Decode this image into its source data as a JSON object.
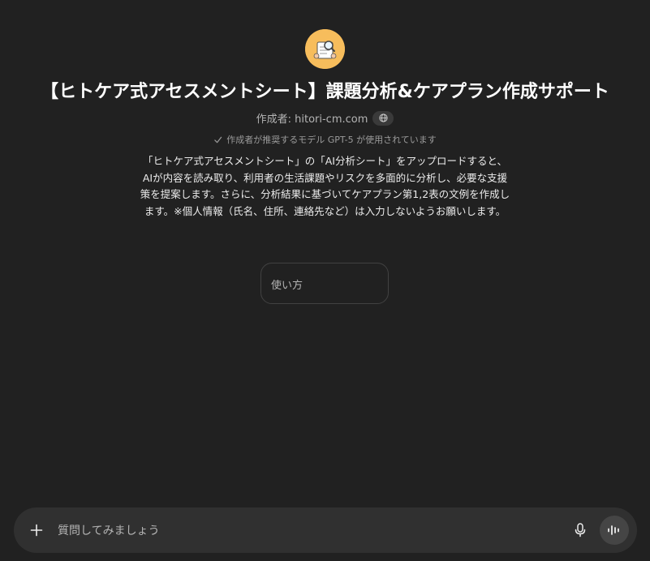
{
  "gpt": {
    "title": "【ヒトケア式アセスメントシート】課題分析&ケアプラン作成サポート",
    "author_label": "作成者: hitori-cm.com",
    "model_note": "作成者が推奨するモデル GPT-5 が使用されています",
    "description": "「ヒトケア式アセスメントシート」の「AI分析シート」をアップロードすると、AIが内容を読み取り、利用者の生活課題やリスクを多面的に分析し、必要な支援策を提案します。さらに、分析結果に基づいてケアプラン第1,2表の文例を作成します。※個人情報（氏名、住所、連絡先など）は入力しないようお願いします。"
  },
  "starters": [
    {
      "label": "使い方"
    }
  ],
  "composer": {
    "placeholder": "質問してみましょう"
  },
  "icons": {
    "add": "plus-icon",
    "mic": "microphone-icon",
    "voice": "voice-mode-icon",
    "globe": "globe-icon",
    "check": "check-icon"
  },
  "colors": {
    "background": "#212121",
    "composer": "#303030",
    "avatar": "#f7bd5c"
  }
}
